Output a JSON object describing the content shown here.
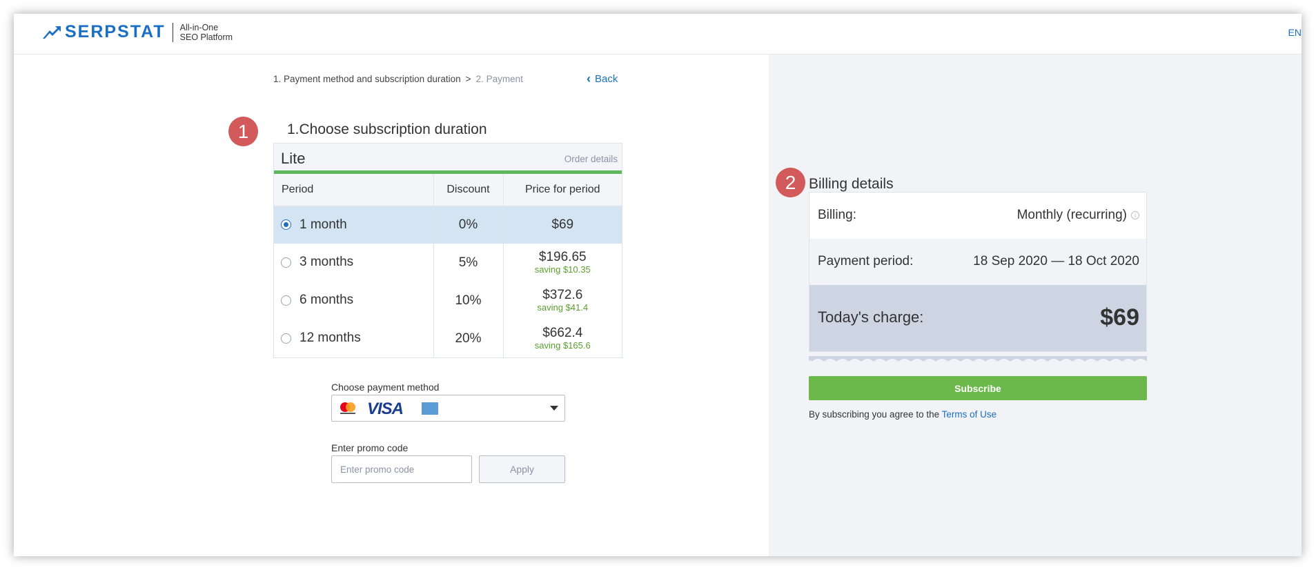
{
  "header": {
    "logo_text": "SERPSTAT",
    "logo_sub_line1": "All-in-One",
    "logo_sub_line2": "SEO Platform",
    "language": "EN"
  },
  "breadcrumb": {
    "step1": "1. Payment method and subscription duration",
    "separator": ">",
    "step2": "2. Payment"
  },
  "back_label": "Back",
  "step_badges": [
    "1",
    "2"
  ],
  "subscription": {
    "title": "1.Choose subscription duration",
    "plan_name": "Lite",
    "order_details": "Order details",
    "columns": [
      "Period",
      "Discount",
      "Price for period"
    ],
    "rows": [
      {
        "period": "1 month",
        "discount": "0%",
        "price": "$69",
        "saving": "",
        "selected": true
      },
      {
        "period": "3 months",
        "discount": "5%",
        "price": "$196.65",
        "saving": "saving $10.35",
        "selected": false
      },
      {
        "period": "6 months",
        "discount": "10%",
        "price": "$372.6",
        "saving": "saving $41.4",
        "selected": false
      },
      {
        "period": "12 months",
        "discount": "20%",
        "price": "$662.4",
        "saving": "saving $165.6",
        "selected": false
      }
    ]
  },
  "payment": {
    "label": "Choose payment method",
    "selected_icons": [
      "mastercard-icon",
      "visa-icon",
      "amex-icon"
    ],
    "visa_text": "VISA"
  },
  "promo": {
    "label": "Enter promo code",
    "placeholder": "Enter promo code",
    "apply_label": "Apply"
  },
  "billing": {
    "title": "Billing details",
    "billing_label": "Billing:",
    "billing_value": "Monthly (recurring)",
    "period_label": "Payment period:",
    "period_value": "18 Sep 2020 — 18 Oct 2020",
    "charge_label": "Today's charge:",
    "charge_value": "$69",
    "subscribe_label": "Subscribe",
    "agree_text": "By subscribing you agree to the ",
    "terms_link": "Terms of Use"
  },
  "colors": {
    "brand_blue": "#1a6fc4",
    "badge_red": "#d25a5a",
    "accent_green": "#5cb85c",
    "subscribe_green": "#6cb84a",
    "selected_row": "#d4e4f2",
    "charge_bg": "#cdd5e2"
  }
}
